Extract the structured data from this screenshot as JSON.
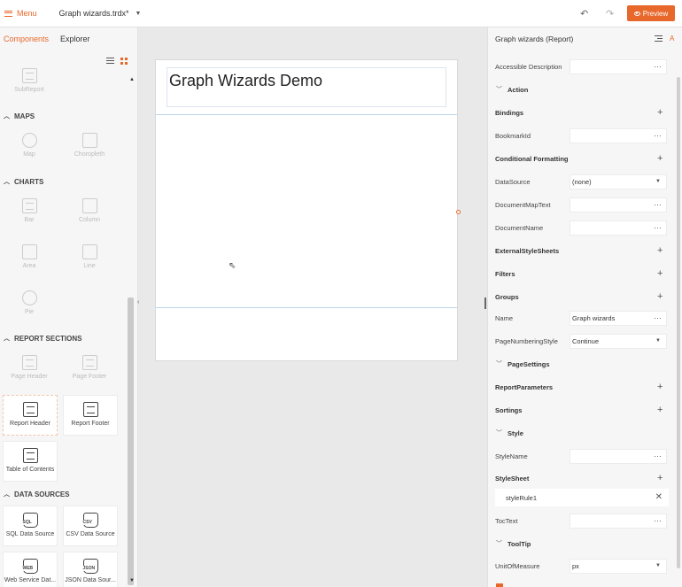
{
  "topbar": {
    "menu_label": "Menu",
    "file_name": "Graph wizards.trdx*",
    "preview_label": "Preview",
    "accent_color": "#e8672a"
  },
  "left_panel": {
    "tabs": [
      "Components",
      "Explorer"
    ],
    "items": {
      "subreport": "SubReport",
      "maps_section": "MAPS",
      "map": "Map",
      "choropleth": "Choropleth",
      "charts_section": "CHARTS",
      "bar": "Bar",
      "column": "Column",
      "area": "Area",
      "line": "Line",
      "pie": "Pie",
      "report_sections": "REPORT SECTIONS",
      "page_header": "Page Header",
      "page_footer": "Page Footer",
      "report_header": "Report Header",
      "report_footer": "Report Footer",
      "toc": "Table of Contents",
      "data_sources": "DATA SOURCES",
      "sql": "SQL Data Source",
      "csv": "CSV Data Source",
      "web": "Web Service Dat...",
      "json": "JSON Data Sour...",
      "sql_badge": "SQL",
      "csv_badge": "CSV",
      "web_badge": "WEB",
      "json_badge": "JSON"
    }
  },
  "canvas": {
    "report_title": "Graph Wizards Demo"
  },
  "properties": {
    "header": "Graph wizards (Report)",
    "az_label": "A",
    "rows": {
      "accessible_description": "Accessible Description",
      "action": "Action",
      "bindings": "Bindings",
      "bookmark_id": "BookmarkId",
      "conditional_formatting": "Conditional Formatting",
      "data_source": "DataSource",
      "data_source_value": "(none)",
      "document_map_text": "DocumentMapText",
      "document_name": "DocumentName",
      "external_style_sheets": "ExternalStyleSheets",
      "filters": "Filters",
      "groups": "Groups",
      "name": "Name",
      "name_value": "Graph wizards",
      "page_numbering_style": "PageNumberingStyle",
      "page_numbering_value": "Continue",
      "page_settings": "PageSettings",
      "report_parameters": "ReportParameters",
      "sortings": "Sortings",
      "style": "Style",
      "style_name": "StyleName",
      "style_sheet": "StyleSheet",
      "style_rule": "styleRule1",
      "toc_text": "TocText",
      "tool_tip": "ToolTip",
      "unit_of_measure": "UnitOfMeasure",
      "unit_value": "px"
    }
  }
}
